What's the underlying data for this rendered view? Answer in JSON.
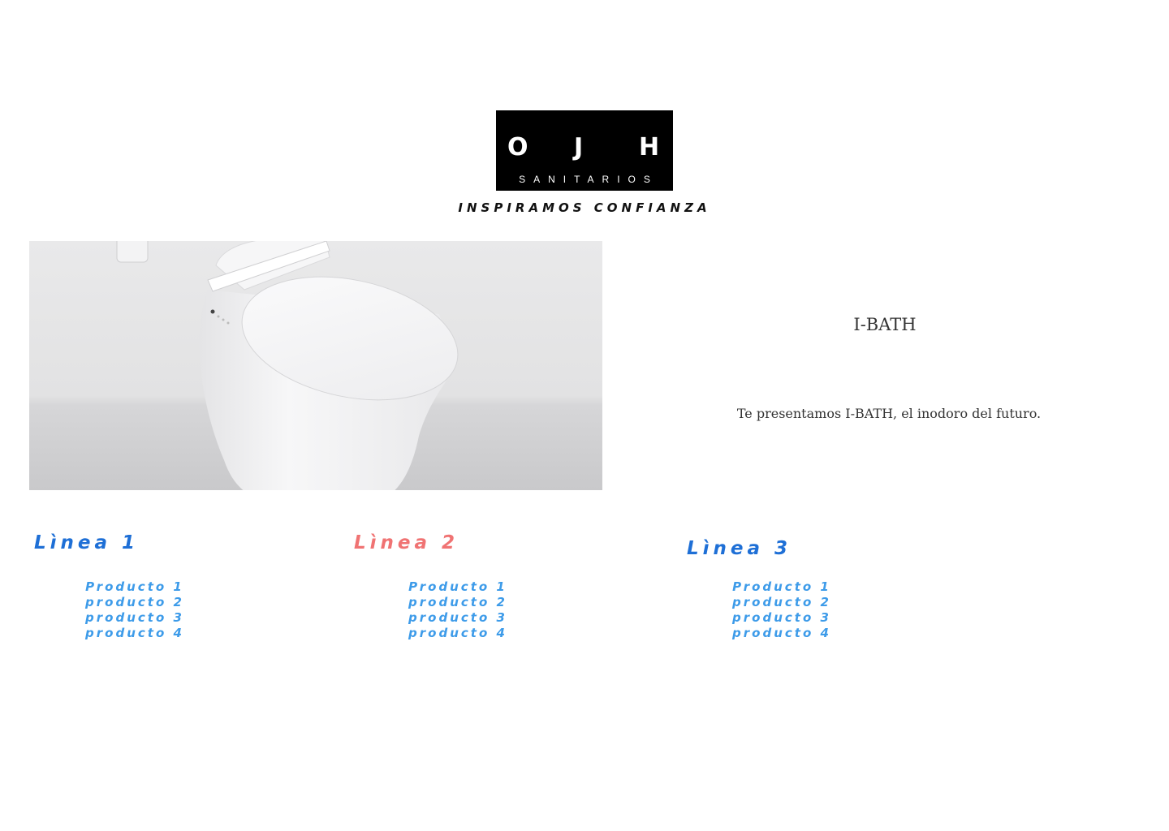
{
  "logo": {
    "letters": [
      "O",
      "J",
      "H"
    ],
    "subtitle": "SANITARIOS"
  },
  "tagline": "INSPIRAMOS CONFIANZA",
  "hero": {
    "image": "white-smart-toilet-photo"
  },
  "product": {
    "title": "I-BATH",
    "description": "Te presentamos I-BATH, el inodoro del futuro."
  },
  "lines": [
    {
      "title": "Lìnea 1",
      "color": "#1e6fd6",
      "products": [
        "Producto 1",
        "producto 2",
        "producto 3",
        "producto 4"
      ]
    },
    {
      "title": "Lìnea 2",
      "color": "#f07373",
      "products": [
        "Producto 1",
        "producto 2",
        "producto 3",
        "producto 4"
      ]
    },
    {
      "title": "Lìnea 3",
      "color": "#1e6fd6",
      "products": [
        "Producto 1",
        "producto 2",
        "producto 3",
        "producto 4"
      ]
    }
  ],
  "colors": {
    "logo_bg": "#000000",
    "product_link": "#3d9be9"
  }
}
